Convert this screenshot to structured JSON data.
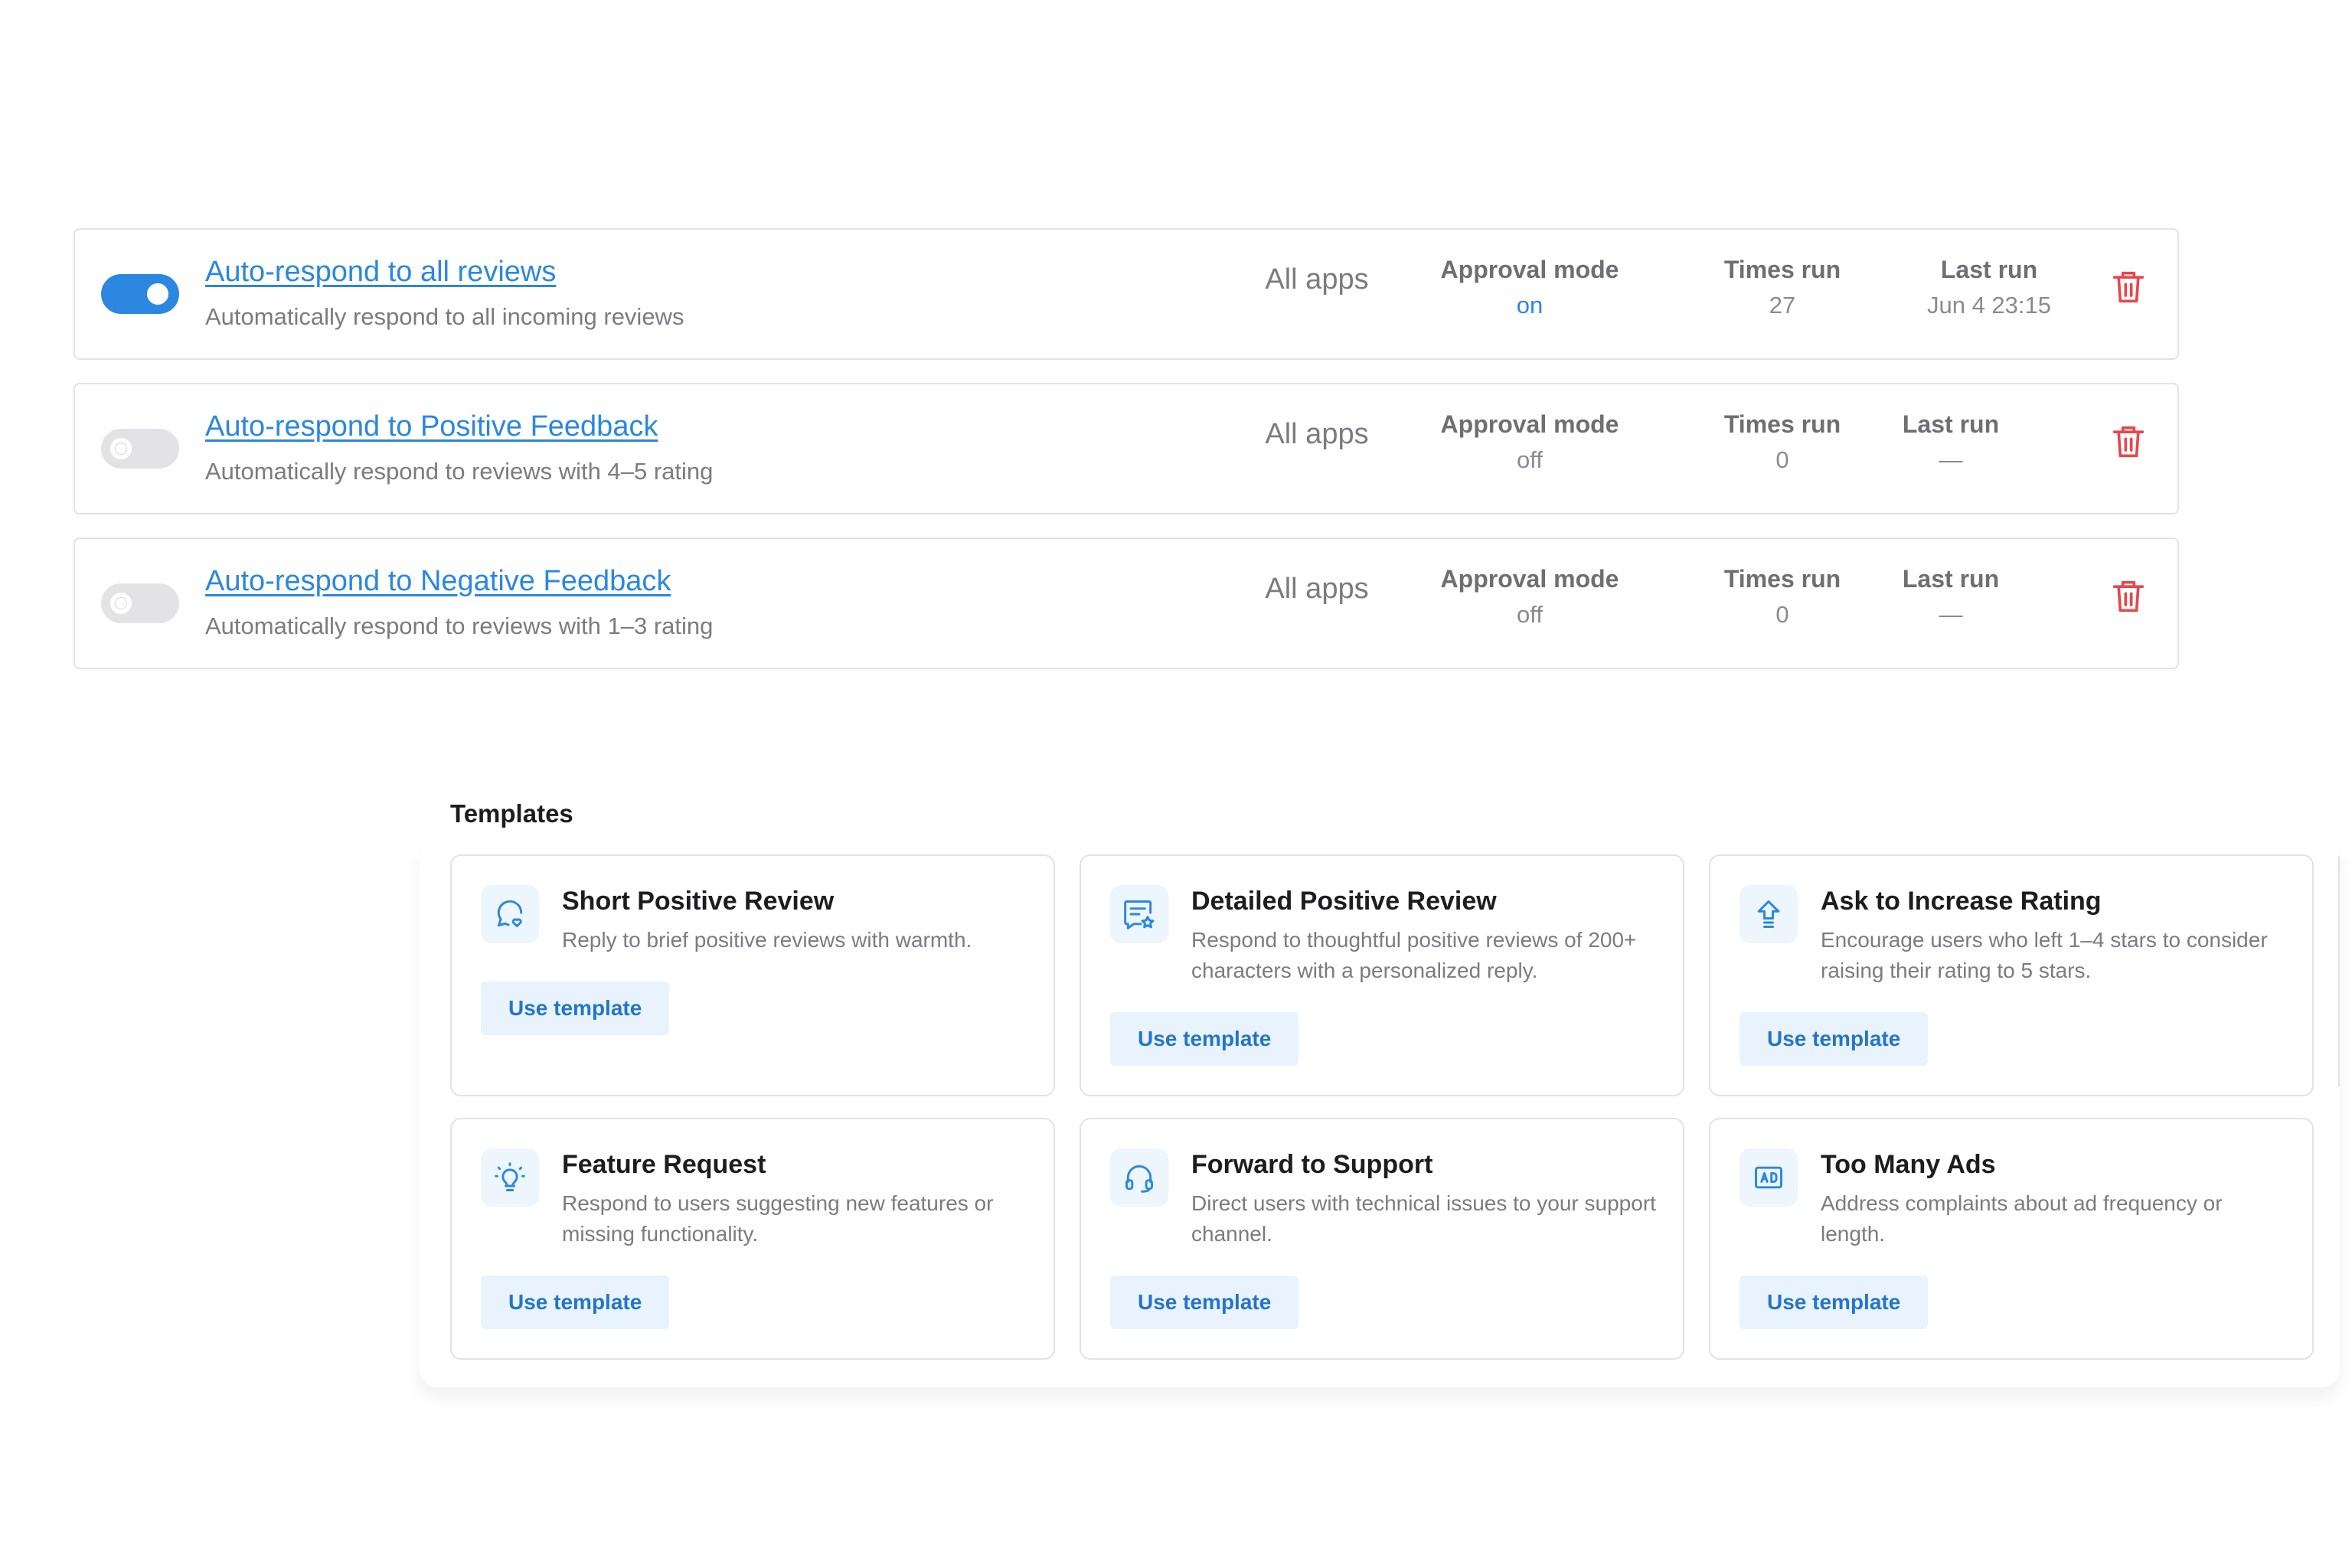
{
  "rules": [
    {
      "enabled": true,
      "title": "Auto-respond to all reviews",
      "description": "Automatically respond to all incoming reviews",
      "scope": "All apps",
      "approval_label": "Approval mode",
      "approval_value": "on",
      "times_label": "Times run",
      "times_value": "27",
      "last_label": "Last run",
      "last_value": "Jun 4 23:15"
    },
    {
      "enabled": false,
      "title": "Auto-respond to Positive Feedback",
      "description": "Automatically respond to reviews with 4–5 rating",
      "scope": "All apps",
      "approval_label": "Approval mode",
      "approval_value": "off",
      "times_label": "Times run",
      "times_value": "0",
      "last_label": "Last run",
      "last_value": "—"
    },
    {
      "enabled": false,
      "title": "Auto-respond to Negative Feedback",
      "description": "Automatically respond to reviews with 1–3 rating",
      "scope": "All apps",
      "approval_label": "Approval mode",
      "approval_value": "off",
      "times_label": "Times run",
      "times_value": "0",
      "last_label": "Last run",
      "last_value": "—"
    }
  ],
  "templates": {
    "heading": "Templates",
    "items": [
      {
        "icon": "chat-heart-icon",
        "title": "Short Positive Review",
        "description": "Reply to brief positive reviews with warmth.",
        "button": "Use template"
      },
      {
        "icon": "message-star-icon",
        "title": "Detailed Positive Review",
        "description": "Respond to thoughtful positive reviews of 200+ characters with a personalized reply.",
        "button": "Use template"
      },
      {
        "icon": "arrow-up-icon",
        "title": "Ask to Increase Rating",
        "description": "Encourage users who left 1–4 stars to consider raising their rating to 5 stars.",
        "button": "Use template"
      },
      {
        "icon": "lightbulb-icon",
        "title": "Feature Request",
        "description": "Respond to users suggesting new features or missing functionality.",
        "button": "Use template"
      },
      {
        "icon": "headset-icon",
        "title": "Forward to Support",
        "description": "Direct users with technical issues to your support channel.",
        "button": "Use template"
      },
      {
        "icon": "ad-icon",
        "title": "Too Many Ads",
        "description": "Address complaints about ad frequency or length.",
        "button": "Use template"
      }
    ]
  },
  "colors": {
    "accent": "#2b87e0",
    "danger": "#e5484d",
    "muted_text": "#7b7b80",
    "border": "#e3e3e6"
  }
}
